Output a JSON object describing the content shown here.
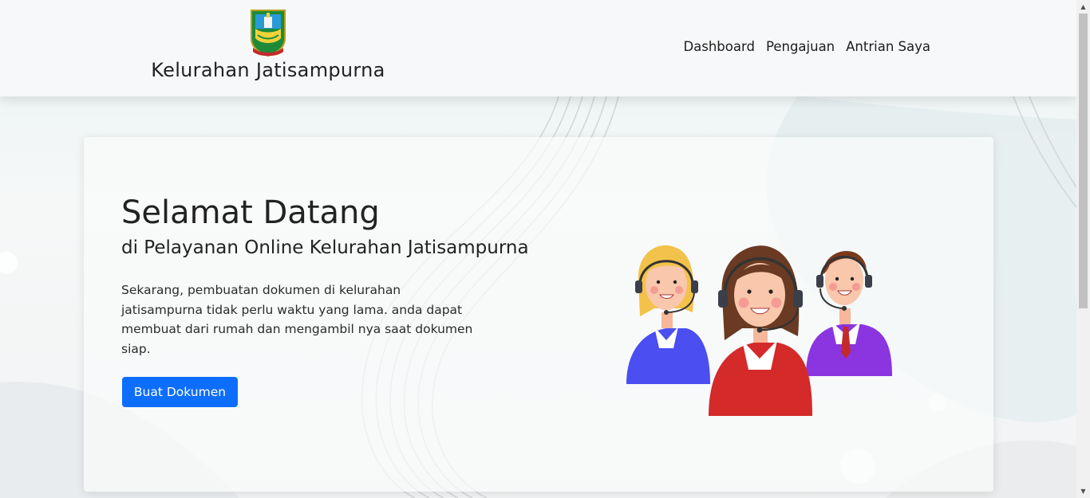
{
  "header": {
    "site_name": "Kelurahan Jatisampurna",
    "nav": {
      "dashboard": "Dashboard",
      "pengajuan": "Pengajuan",
      "antrian_saya": "Antrian Saya"
    }
  },
  "hero": {
    "title": "Selamat Datang",
    "subtitle": "di Pelayanan Online Kelurahan Jatisampurna",
    "description": "Sekarang, pembuatan dokumen di kelurahan jatisampurna tidak perlu waktu yang lama. anda dapat membuat dari rumah dan mengambil nya saat dokumen siap.",
    "button_label": "Buat Dokumen"
  },
  "icons": {
    "logo": "kota-bekasi-emblem",
    "illustration": "customer-service-agents-illustration",
    "scroll_up": "triangle-up-icon",
    "scroll_down": "triangle-down-icon"
  },
  "colors": {
    "primary_button": "#0d6efd",
    "agent_left": "#4b4ef0",
    "agent_center": "#d42a2a",
    "agent_right": "#8a35e0"
  }
}
